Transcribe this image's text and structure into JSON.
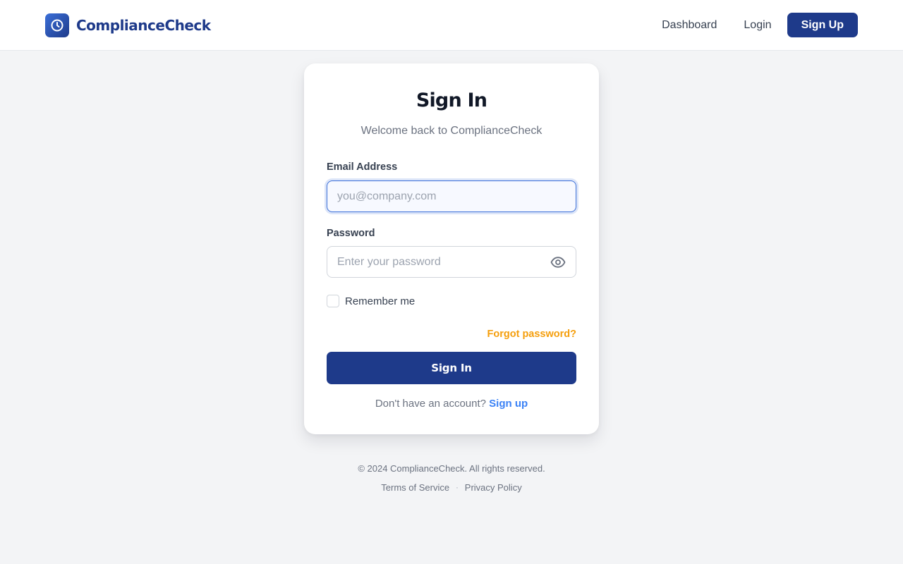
{
  "header": {
    "brand_name": "ComplianceCheck",
    "brand_icon": "clock-icon",
    "nav": {
      "dashboard_label": "Dashboard",
      "login_label": "Login",
      "signup_label": "Sign Up"
    }
  },
  "signin_card": {
    "title": "Sign In",
    "subtitle": "Welcome back to ComplianceCheck",
    "email": {
      "label": "Email Address",
      "placeholder": "you@company.com",
      "value": ""
    },
    "password": {
      "label": "Password",
      "placeholder": "Enter your password",
      "value": "",
      "toggle_icon": "eye-icon"
    },
    "remember_label": "Remember me",
    "remember_checked": false,
    "forgot_label": "Forgot password?",
    "submit_label": "Sign In",
    "signup_prompt": "Don't have an account?",
    "signup_link_label": "Sign up"
  },
  "footer": {
    "copyright": "© 2024 ComplianceCheck. All rights reserved.",
    "terms_label": "Terms of Service",
    "separator": "·",
    "privacy_label": "Privacy Policy"
  },
  "colors": {
    "brand": "#1e3a8a",
    "accent_link": "#3b82f6",
    "warning_link": "#f59e0b",
    "page_background": "#f3f4f6"
  }
}
